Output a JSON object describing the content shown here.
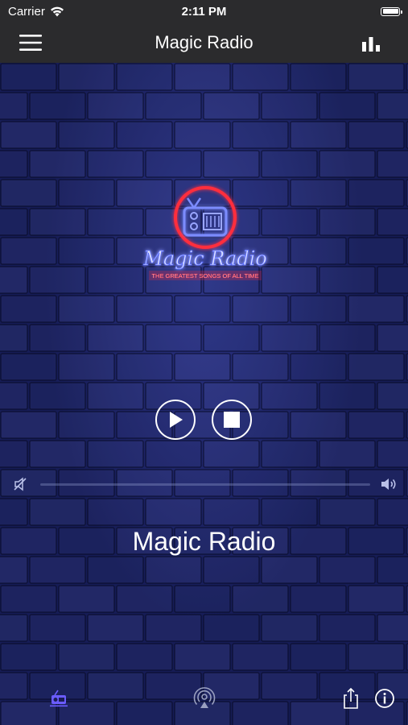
{
  "status_bar": {
    "carrier": "Carrier",
    "time": "2:11 PM"
  },
  "nav": {
    "title": "Magic Radio",
    "left_icon": "hamburger-menu-icon",
    "right_icon": "equalizer-bars-icon"
  },
  "logo": {
    "title": "Magic Radio",
    "tagline": "THE GREATEST SONGS OF ALL TIME"
  },
  "player": {
    "play_icon": "play-icon",
    "stop_icon": "stop-icon",
    "volume_level": 0.0
  },
  "station": {
    "name": "Magic Radio"
  },
  "toolbar": {
    "items": [
      "radio-icon",
      "airplay-icon",
      "share-icon",
      "info-icon"
    ]
  },
  "colors": {
    "bar": "#2b2b2d",
    "wall": "#161c56",
    "neon_red": "#ff2d3d",
    "neon_blue": "#5a6dff"
  }
}
